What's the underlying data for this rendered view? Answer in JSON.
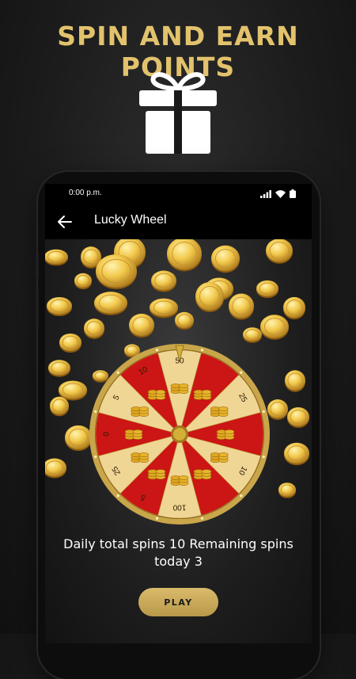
{
  "promo": {
    "headline": "SPIN AND EARN POINTS",
    "gift_icon": "gift-icon",
    "accent_color": "#e2c26c"
  },
  "status_bar": {
    "time": "0:00 p.m.",
    "icons": [
      "signal-icon",
      "wifi-icon",
      "battery-icon"
    ]
  },
  "app_bar": {
    "back_icon": "arrow-left-icon",
    "title": "Lucky Wheel"
  },
  "wheel": {
    "segments": [
      {
        "label": "50",
        "color": "#f0d695"
      },
      {
        "label": "",
        "color": "#cc1515"
      },
      {
        "label": "25",
        "color": "#f0d695"
      },
      {
        "label": "",
        "color": "#cc1515"
      },
      {
        "label": "10",
        "color": "#f0d695"
      },
      {
        "label": "",
        "color": "#cc1515"
      },
      {
        "label": "100",
        "color": "#f0d695"
      },
      {
        "label": "5",
        "color": "#cc1515"
      },
      {
        "label": "25",
        "color": "#f0d695"
      },
      {
        "label": "0",
        "color": "#cc1515"
      },
      {
        "label": "5",
        "color": "#f0d695"
      },
      {
        "label": "10",
        "color": "#cc1515"
      }
    ],
    "rim_color": "#c9a64a",
    "hub_color": "#d4af37"
  },
  "spins": {
    "text_line1": "Daily total spins 10 Remaining spins",
    "text_line2": "today 3"
  },
  "play_button": {
    "label": "PLAY",
    "color": "#d1b060"
  }
}
